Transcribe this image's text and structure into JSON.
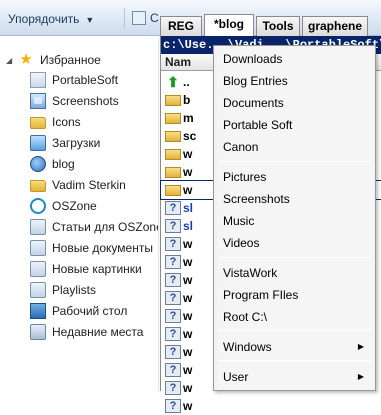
{
  "toolbar": {
    "organize_label": "Упорядочить",
    "organize_arrow": "▼",
    "cut_char": "С"
  },
  "navpane": {
    "favorites_label": "Избранное",
    "items": [
      {
        "label": "PortableSoft",
        "icon": "portable-icon"
      },
      {
        "label": "Screenshots",
        "icon": "image-icon"
      },
      {
        "label": "Icons",
        "icon": "folder-icon"
      },
      {
        "label": "Загрузки",
        "icon": "download-icon"
      },
      {
        "label": "blog",
        "icon": "globe-icon"
      },
      {
        "label": "Vadim Sterkin",
        "icon": "folder-icon"
      },
      {
        "label": "OSZone",
        "icon": "oszone-icon"
      },
      {
        "label": "Статьи для OSZone",
        "icon": "library-icon"
      },
      {
        "label": "Новые документы",
        "icon": "library-icon"
      },
      {
        "label": "Новые картинки",
        "icon": "library-icon"
      },
      {
        "label": "Playlists",
        "icon": "library-icon"
      },
      {
        "label": "Рабочий стол",
        "icon": "desktop-icon"
      },
      {
        "label": "Недавние места",
        "icon": "recent-icon"
      }
    ]
  },
  "tabs": [
    {
      "label": "REG",
      "active": false
    },
    {
      "label": "*blog",
      "active": true
    },
    {
      "label": "Tools",
      "active": false
    },
    {
      "label": "graphene",
      "active": false
    }
  ],
  "panel": {
    "path": "c:\\Use...\\Vadi...\\PortableSoft\\...",
    "col_name": "Nam",
    "rows": [
      {
        "icon": "up",
        "text": ".."
      },
      {
        "icon": "folder",
        "text": "b"
      },
      {
        "icon": "folder",
        "text": "m"
      },
      {
        "icon": "folder",
        "text": "sc"
      },
      {
        "icon": "folder",
        "text": "w"
      },
      {
        "icon": "folder",
        "text": "w"
      },
      {
        "icon": "folder",
        "text": "w"
      },
      {
        "icon": "q",
        "text": "sl"
      },
      {
        "icon": "q",
        "text": "sl"
      },
      {
        "icon": "q",
        "text": "w"
      },
      {
        "icon": "q",
        "text": "w"
      },
      {
        "icon": "q",
        "text": "w"
      },
      {
        "icon": "q",
        "text": "w"
      },
      {
        "icon": "q",
        "text": "w"
      },
      {
        "icon": "q",
        "text": "w"
      },
      {
        "icon": "q",
        "text": "w"
      },
      {
        "icon": "q",
        "text": "w"
      },
      {
        "icon": "q",
        "text": "w"
      },
      {
        "icon": "q",
        "text": "w"
      }
    ]
  },
  "menu": {
    "groups": [
      [
        "Downloads",
        "Blog Entries",
        "Documents",
        "Portable Soft",
        "Canon"
      ],
      [
        "Pictures",
        "Screenshots",
        "Music",
        "Videos"
      ],
      [
        "VistaWork",
        "Program FIles",
        "Root C:\\"
      ],
      [
        "Windows"
      ],
      [
        "User"
      ]
    ],
    "submenu_items": [
      "Windows",
      "User"
    ],
    "submenu_arrow": "▶"
  }
}
